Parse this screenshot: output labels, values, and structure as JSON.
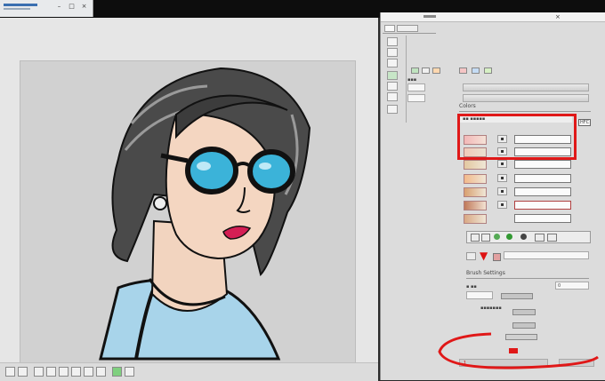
{
  "colors": {
    "accent_red": "#e01818",
    "panel_bg": "#dcdcdc",
    "canvas_bg": "#d1d1d1"
  },
  "mini_window": {
    "title_bar_icon": "progress-bar-icon",
    "minimize_label": "–",
    "maximize_label": "□",
    "close_label": "×"
  },
  "right_panel": {
    "title_close_label": "×",
    "section_label": "Colors",
    "header_tag": "HFC",
    "option_label": "Brush Settings",
    "status_value": "0",
    "bottom_value": "1"
  },
  "toolbar_icons": [
    "select-icon",
    "move-icon",
    "zoom-icon",
    "rotate-icon",
    "crop-icon",
    "grid-icon",
    "brush-icon",
    "eraser-icon",
    "text-icon",
    "layer-icon"
  ]
}
